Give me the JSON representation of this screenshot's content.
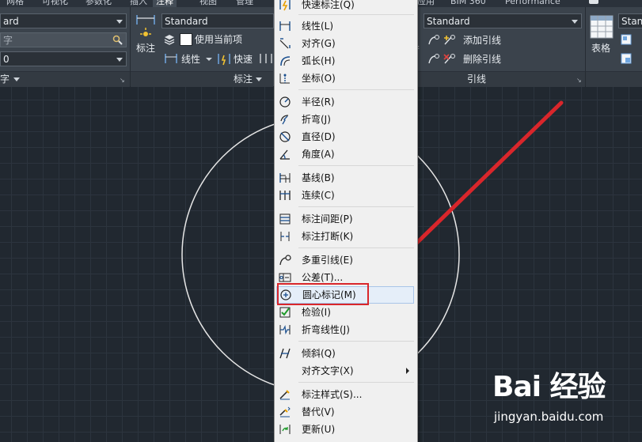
{
  "tabs": [
    {
      "label": "网格"
    },
    {
      "label": "可视化"
    },
    {
      "label": "参数化"
    },
    {
      "label": "插入"
    },
    {
      "label": "注释"
    },
    {
      "label": "视图"
    },
    {
      "label": "管理"
    },
    {
      "label": "应用"
    },
    {
      "label": "BIM 360"
    },
    {
      "label": "Performance"
    }
  ],
  "ribbon": {
    "text_panel": {
      "style_value": "ard",
      "search_placeholder": "字",
      "height_value": "0",
      "footer_label": "字"
    },
    "dim_panel": {
      "big_button_label": "标注",
      "style_value": "Standard",
      "layer_label": "使用当前项",
      "linear_label": "线性",
      "quick_label": "快速",
      "footer_label": "标注"
    },
    "leader_panel": {
      "style_value": "Standard",
      "add_label": "添加引线",
      "remove_label": "删除引线",
      "footer_label": "引线"
    },
    "table_panel": {
      "big_button_label": "表格",
      "style_value": "Standa"
    }
  },
  "menu": {
    "top_item": "快速标注(Q)",
    "groups": [
      [
        {
          "label": "线性(L)",
          "icon": "linear-dim-icon"
        },
        {
          "label": "对齐(G)",
          "icon": "aligned-dim-icon"
        },
        {
          "label": "弧长(H)",
          "icon": "arc-length-icon"
        },
        {
          "label": "坐标(O)",
          "icon": "ordinate-icon"
        }
      ],
      [
        {
          "label": "半径(R)",
          "icon": "radius-icon"
        },
        {
          "label": "折弯(J)",
          "icon": "jogged-icon"
        },
        {
          "label": "直径(D)",
          "icon": "diameter-icon"
        },
        {
          "label": "角度(A)",
          "icon": "angle-icon"
        }
      ],
      [
        {
          "label": "基线(B)",
          "icon": "baseline-icon"
        },
        {
          "label": "连续(C)",
          "icon": "continue-icon"
        }
      ],
      [
        {
          "label": "标注间距(P)",
          "icon": "dim-space-icon"
        },
        {
          "label": "标注打断(K)",
          "icon": "dim-break-icon"
        }
      ],
      [
        {
          "label": "多重引线(E)",
          "icon": "mleader-icon"
        },
        {
          "label": "公差(T)...",
          "icon": "tolerance-icon"
        },
        {
          "label": "圆心标记(M)",
          "icon": "center-mark-icon",
          "highlighted": true
        },
        {
          "label": "检验(I)",
          "icon": "inspect-icon"
        },
        {
          "label": "折弯线性(J)",
          "icon": "jogged-linear-icon"
        }
      ],
      [
        {
          "label": "倾斜(Q)",
          "icon": "oblique-icon"
        },
        {
          "label": "对齐文字(X)",
          "icon": "",
          "submenu": true
        }
      ],
      [
        {
          "label": "标注样式(S)...",
          "icon": "dim-style-icon"
        },
        {
          "label": "替代(V)",
          "icon": "override-icon"
        },
        {
          "label": "更新(U)",
          "icon": "update-icon"
        }
      ]
    ]
  },
  "annotation_colors": {
    "arrow": "#d9262b",
    "highlight_box": "#d9262b"
  },
  "watermark": {
    "logo": "Bai 经验",
    "url": "jingyan.baidu.com"
  }
}
